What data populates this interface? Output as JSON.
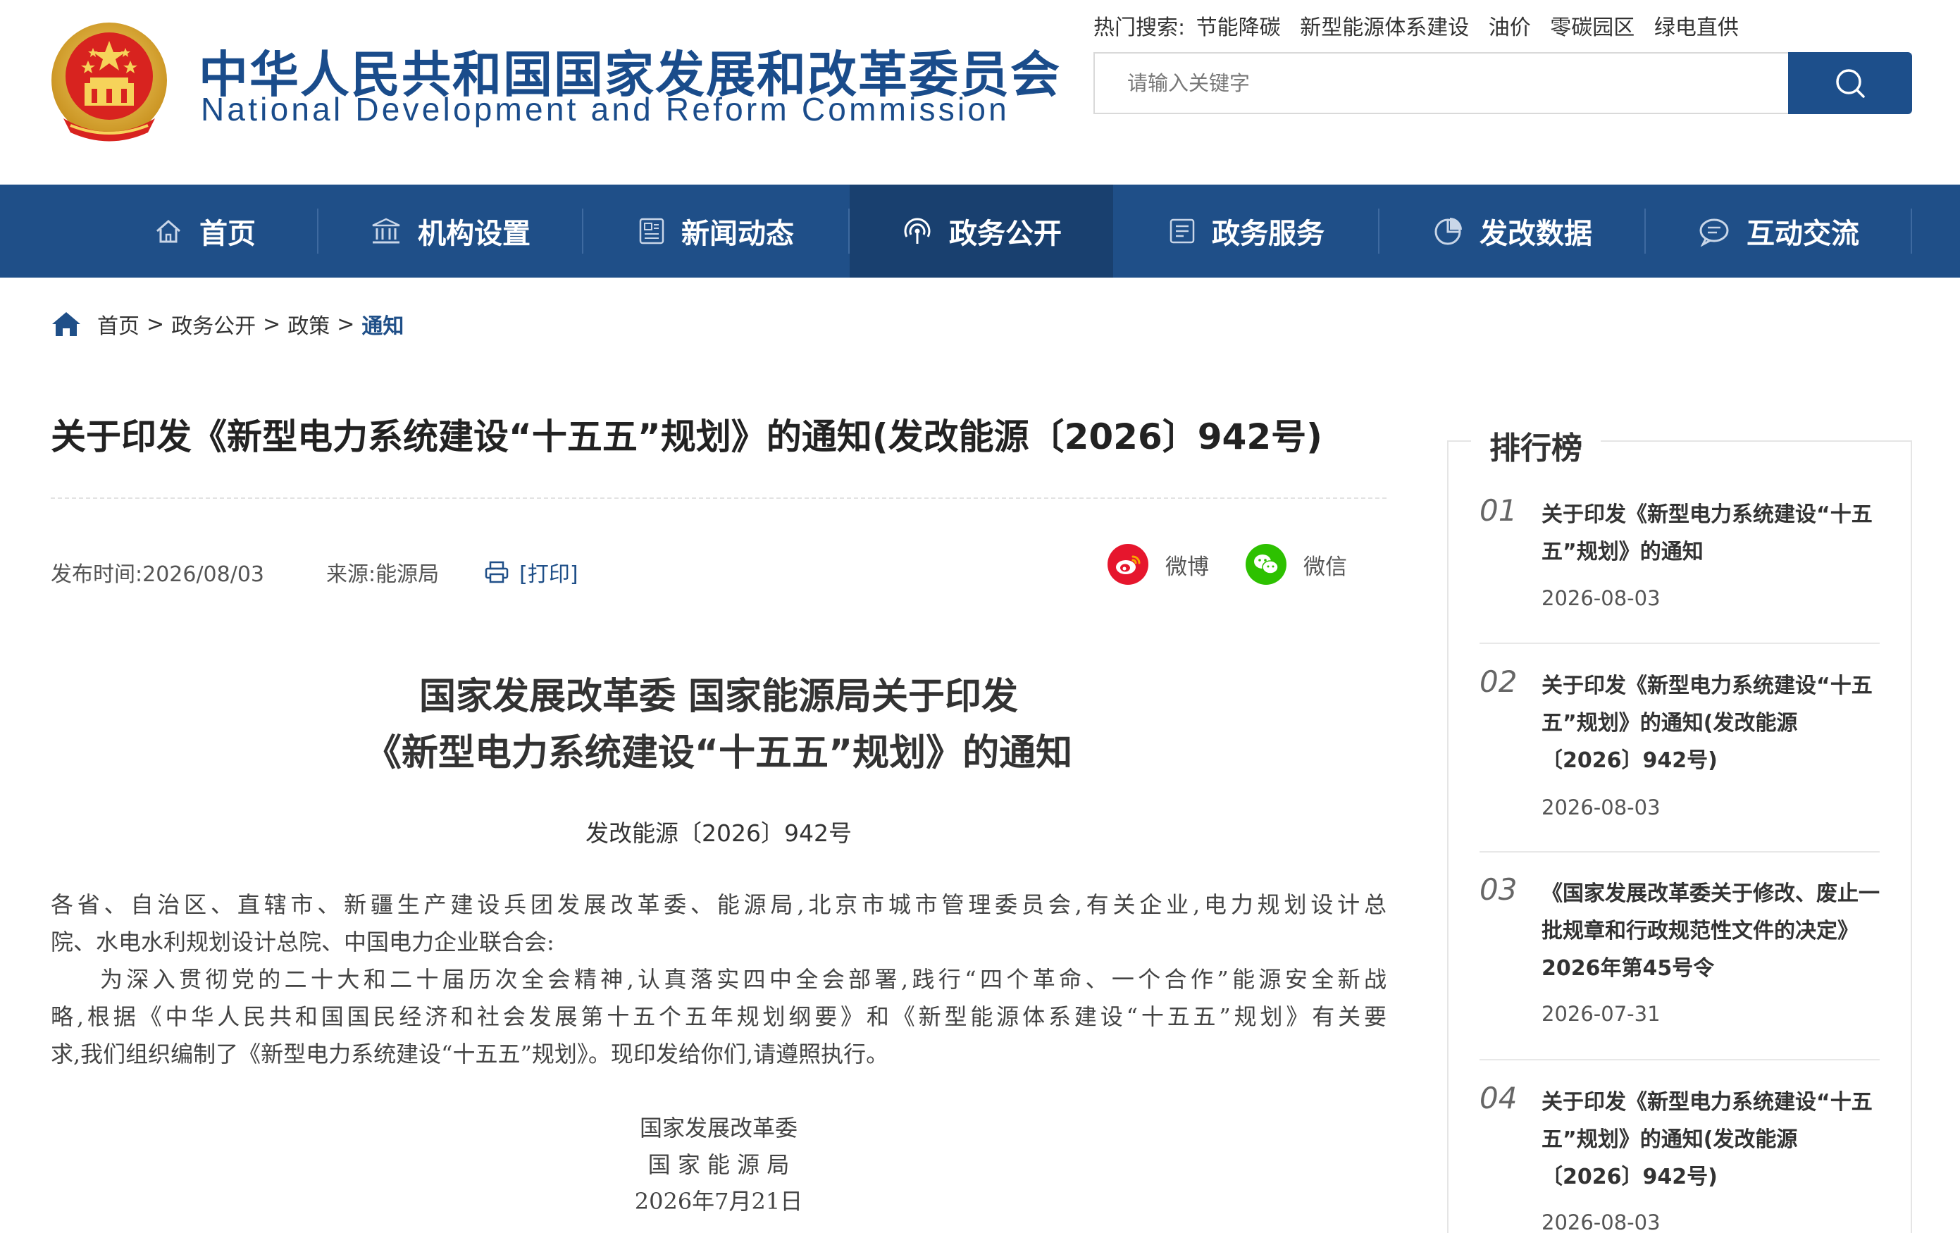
{
  "header": {
    "title_cn": "中华人民共和国国家发展和改革委员会",
    "title_en": "National Development and Reform Commission",
    "hot_label": "热门搜索:",
    "hot_items": [
      "节能降碳",
      "新型能源体系建设",
      "油价",
      "零碳园区",
      "绿电直供"
    ],
    "search_placeholder": "请输入关键字"
  },
  "nav": {
    "items": [
      {
        "label": "首页",
        "icon": "home-icon"
      },
      {
        "label": "机构设置",
        "icon": "institution-icon"
      },
      {
        "label": "新闻动态",
        "icon": "news-icon"
      },
      {
        "label": "政务公开",
        "icon": "broadcast-icon",
        "active": true
      },
      {
        "label": "政务服务",
        "icon": "service-icon"
      },
      {
        "label": "发改数据",
        "icon": "pie-chart-icon"
      },
      {
        "label": "互动交流",
        "icon": "chat-icon"
      }
    ]
  },
  "breadcrumb": {
    "items": [
      "首页",
      "政务公开",
      "政策"
    ],
    "current": "通知",
    "sep": ">"
  },
  "article": {
    "title": "关于印发《新型电力系统建设“十五五”规划》的通知(发改能源〔2026〕942号)",
    "publish_time": "发布时间:2026/08/03",
    "source": "来源:能源局",
    "print": "[打印]",
    "share_weibo": "微博",
    "share_wechat": "微信",
    "doc_title_line1": "国家发展改革委 国家能源局关于印发",
    "doc_title_line2": "《新型电力系统建设“十五五”规划》的通知",
    "doc_number": "发改能源〔2026〕942号",
    "body_lines": [
      "各省、自治区、直辖市、新疆生产建设兵团发展改革委、能源局,北京市城市管理委员会,有关企业,电力规划设计总",
      "院、水电水利规划设计总院、中国电力企业联合会:",
      "为深入贯彻党的二十大和二十届历次全会精神,认真落实四中全会部署,践行“四个革命、一个合作”能源安全新战",
      "略,根据《中华人民共和国国民经济和社会发展第十五个五年规划纲要》和《新型能源体系建设“十五五”规划》有关要",
      "求,我们组织编制了《新型电力系统建设“十五五”规划》。现印发给你们,请遵照执行。"
    ],
    "sign_org1": "国家发展改革委",
    "sign_org2": "国 家 能 源 局",
    "sign_date": "2026年7月21日"
  },
  "ranking": {
    "title": "排行榜",
    "items": [
      {
        "num": "01",
        "title": "关于印发《新型电力系统建设“十五五”规划》的通知",
        "date": "2026-08-03"
      },
      {
        "num": "02",
        "title": "关于印发《新型电力系统建设“十五五”规划》的通知(发改能源〔2026〕942号)",
        "date": "2026-08-03"
      },
      {
        "num": "03",
        "title": "《国家发展改革委关于修改、废止一批规章和行政规范性文件的决定》 2026年第45号令",
        "date": "2026-07-31"
      },
      {
        "num": "04",
        "title": "关于印发《新型电力系统建设“十五五”规划》的通知(发改能源〔2026〕942号)",
        "date": "2026-08-03"
      }
    ]
  },
  "colors": {
    "brand_blue": "#1f4f88",
    "nav_active": "#19406f",
    "weibo_red": "#e6162d",
    "wechat_green": "#2dc100"
  }
}
